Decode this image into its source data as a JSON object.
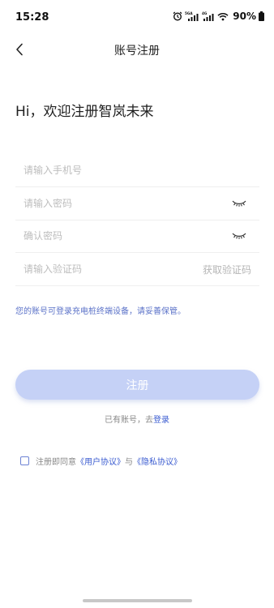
{
  "status_bar": {
    "time": "15:28",
    "signal1_label": "5GA",
    "signal2_label": "4G",
    "battery": "90%"
  },
  "nav": {
    "title": "账号注册"
  },
  "greeting": "Hi，欢迎注册智岚未来",
  "form": {
    "phone_placeholder": "请输入手机号",
    "password_placeholder": "请输入密码",
    "confirm_placeholder": "确认密码",
    "code_placeholder": "请输入验证码",
    "get_code": "获取验证码"
  },
  "note": "您的账号可登录充电桩终端设备，请妥善保管。",
  "register_button": "注册",
  "login": {
    "prefix": "已有账号，去",
    "link": "登录"
  },
  "agreement": {
    "prefix": "注册即同意",
    "user_agreement": "《用户协议》",
    "and": "与",
    "privacy_agreement": "《隐私协议》"
  },
  "colors": {
    "accent": "#3a5bd0",
    "button": "#c5d1f6",
    "note": "#5b72c8"
  }
}
